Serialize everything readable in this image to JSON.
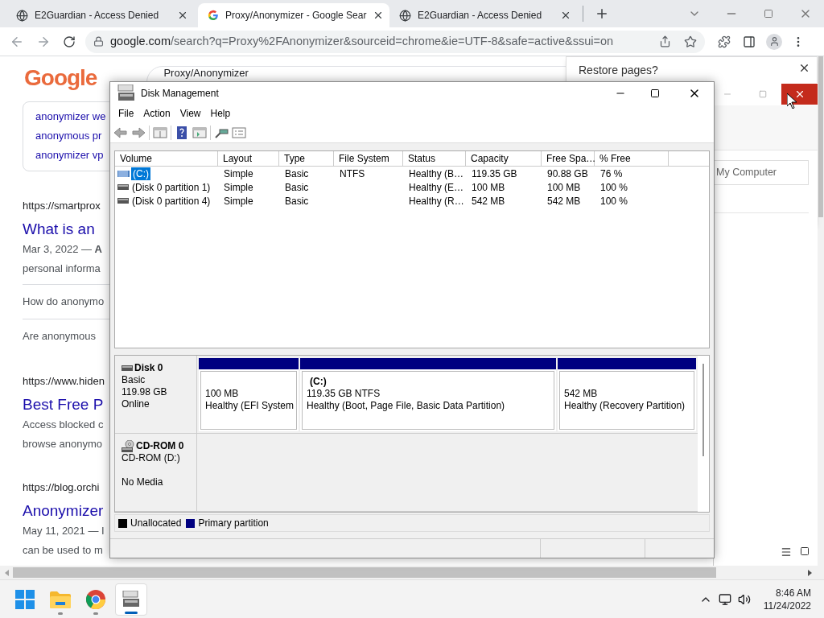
{
  "browser": {
    "tabs": [
      {
        "title": "E2Guardian - Access Denied",
        "selected": false,
        "kind": "globe"
      },
      {
        "title": "Proxy/Anonymizer - Google Sear",
        "selected": true,
        "kind": "google"
      },
      {
        "title": "E2Guardian - Access Denied",
        "selected": false,
        "kind": "globe"
      }
    ],
    "url_host": "google.com",
    "url_path": "/search?q=Proxy%2FAnonymizer&sourceid=chrome&ie=UTF-8&safe=active&ssui=on",
    "logo": "Google",
    "query": "Proxy/Anonymizer",
    "related": [
      "anonymizer we",
      "anonymous pr",
      "anonymizer vp"
    ],
    "results": [
      {
        "url": "https://smartprox",
        "title": "What is an",
        "snippet": [
          "Mar 3, 2022 — **A**",
          "personal informa"
        ],
        "questions": [
          "How do anonymo",
          "Are anonymous"
        ]
      },
      {
        "url": "https://www.hiden",
        "title": "Best Free P",
        "snippet": [
          "Access blocked c",
          "browse anonymo"
        ]
      },
      {
        "url": "https://blog.orchi",
        "title": "Anonymizer",
        "snippet": [
          "May 11, 2021 — I",
          "can be used to m"
        ]
      }
    ]
  },
  "restore_dialog": {
    "title": "Restore pages?"
  },
  "back_window": {
    "field": "My Computer"
  },
  "disk_management": {
    "title": "Disk Management",
    "menu": [
      "File",
      "Action",
      "View",
      "Help"
    ],
    "columns": [
      "Volume",
      "Layout",
      "Type",
      "File System",
      "Status",
      "Capacity",
      "Free Spa…",
      "% Free"
    ],
    "volumes": [
      {
        "kind": "striped",
        "selected": true,
        "cells": [
          "(C:)",
          "Simple",
          "Basic",
          "NTFS",
          "Healthy (B…",
          "119.35 GB",
          "90.88 GB",
          "76 %"
        ]
      },
      {
        "kind": "plain",
        "selected": false,
        "cells": [
          "(Disk 0 partition 1)",
          "Simple",
          "Basic",
          "",
          "Healthy (E…",
          "100 MB",
          "100 MB",
          "100 %"
        ]
      },
      {
        "kind": "plain",
        "selected": false,
        "cells": [
          "(Disk 0 partition 4)",
          "Simple",
          "Basic",
          "",
          "Healthy (R…",
          "542 MB",
          "542 MB",
          "100 %"
        ]
      }
    ],
    "disks": [
      {
        "kind": "hdd",
        "name": "Disk 0",
        "type": "Basic",
        "size": "119.98 GB",
        "state": "Online",
        "partitions": [
          {
            "size": "100 MB",
            "status": "Healthy (EFI System"
          },
          {
            "name": "(C:)",
            "size": "119.35 GB NTFS",
            "status": "Healthy (Boot, Page File, Basic Data Partition)"
          },
          {
            "size": "542 MB",
            "status": "Healthy (Recovery Partition)"
          }
        ]
      },
      {
        "kind": "cdrom",
        "name": "CD-ROM 0",
        "type": "CD-ROM (D:)",
        "state": "No Media"
      }
    ],
    "legend": [
      {
        "label": "Unallocated",
        "color": "#000000"
      },
      {
        "label": "Primary partition",
        "color": "#000080"
      }
    ]
  },
  "taskbar": {
    "apps": [
      {
        "kind": "start",
        "running": false,
        "active": false
      },
      {
        "kind": "explorer",
        "running": true,
        "active": false
      },
      {
        "kind": "chrome",
        "running": true,
        "active": false
      },
      {
        "kind": "diskmgmt",
        "running": true,
        "active": true
      }
    ],
    "time": "8:46 AM",
    "date": "11/24/2022"
  }
}
